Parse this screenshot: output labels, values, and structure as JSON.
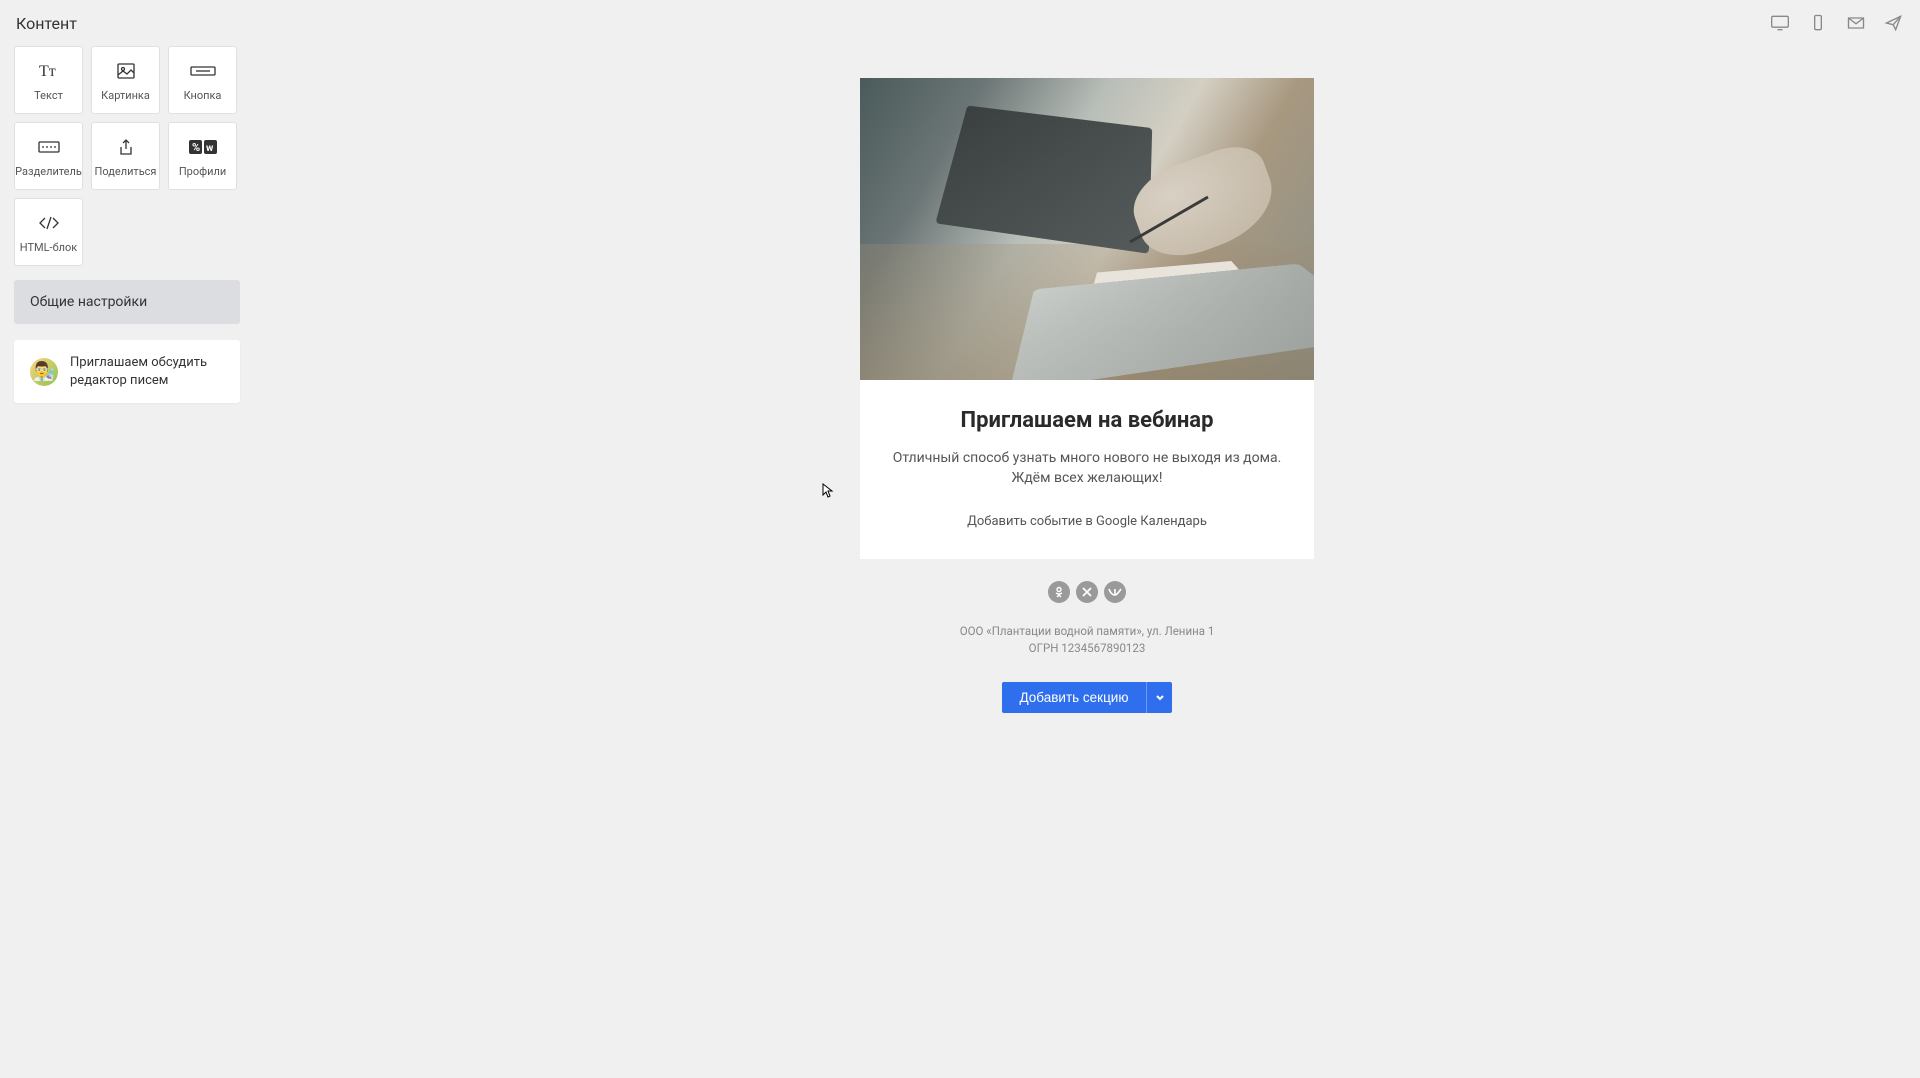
{
  "topbar": {
    "title": "Контент"
  },
  "blocks": {
    "text": "Текст",
    "image": "Картинка",
    "button": "Кнопка",
    "divider": "Разделитель",
    "share": "Поделиться",
    "profiles": "Профили",
    "html": "HTML-блок"
  },
  "sidebar": {
    "settings": "Общие настройки",
    "feedback": "Приглашаем обсудить редактор писем"
  },
  "email": {
    "title": "Приглашаем на вебинар",
    "description": "Отличный способ узнать много нового не выходя из дома. Ждём всех желающих!",
    "calendar_link": "Добавить событие в Google Календарь",
    "footer_line1": "ООО «Плантации водной памяти», ул. Ленина 1",
    "footer_line2": "ОГРН 1234567890123",
    "add_section": "Добавить секцию"
  }
}
